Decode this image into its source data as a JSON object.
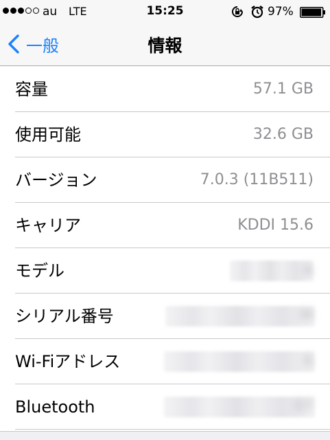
{
  "status_bar": {
    "carrier": "au",
    "network": "LTE",
    "time": "15:25",
    "battery_percent": "97%",
    "battery_level": 0.97,
    "signal_bars_filled": 3,
    "signal_bars_total": 5,
    "icons": [
      "orientation-lock-icon",
      "alarm-icon",
      "battery-icon"
    ]
  },
  "nav": {
    "back_label": "一般",
    "title": "情報"
  },
  "rows": [
    {
      "label": "容量",
      "value": "57.1 GB",
      "blurred": false
    },
    {
      "label": "使用可能",
      "value": "32.6 GB",
      "blurred": false
    },
    {
      "label": "バージョン",
      "value": "7.0.3 (11B511)",
      "blurred": false
    },
    {
      "label": "キャリア",
      "value": "KDDI 15.6",
      "blurred": false
    },
    {
      "label": "モデル",
      "value": "A",
      "blurred": true
    },
    {
      "label": "シリアル番号",
      "value": "M",
      "blurred": true
    },
    {
      "label": "Wi-Fiアドレス",
      "value": "6",
      "blurred": true
    },
    {
      "label": "Bluetooth",
      "value": "07",
      "blurred": true
    }
  ],
  "colors": {
    "accent": "#1a82fb",
    "value_text": "#8e8e93",
    "background": "#efeff4",
    "separator": "#c8c7cc"
  }
}
